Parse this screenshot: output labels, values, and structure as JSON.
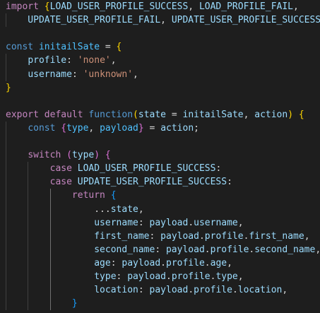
{
  "theme": {
    "background": "#1e1e1e",
    "keyword_control": "#c586c0",
    "keyword_storage": "#569cd6",
    "function": "#dcdcaa",
    "variable": "#9cdcfe",
    "constant": "#4fc1ff",
    "string": "#ce9178",
    "punctuation": "#d4d4d4",
    "bracket_1": "#ffd700",
    "bracket_2": "#da70d6",
    "bracket_3": "#179fff"
  },
  "lines": [
    [
      {
        "t": "import ",
        "c": "keyword_control"
      },
      {
        "t": "{",
        "c": "bracket_1"
      },
      {
        "t": "LOAD_USER_PROFILE_SUCCESS",
        "c": "variable"
      },
      {
        "t": ", ",
        "c": "punctuation"
      },
      {
        "t": "LOAD_PROFILE_FAIL",
        "c": "variable"
      },
      {
        "t": ",",
        "c": "punctuation"
      }
    ],
    [
      {
        "t": "    UPDATE_USER_PROFILE_FAIL",
        "c": "variable"
      },
      {
        "t": ", ",
        "c": "punctuation"
      },
      {
        "t": "UPDATE_USER_PROFILE_SUCCESS",
        "c": "variable"
      },
      {
        "t": ",",
        "c": "punctuation"
      }
    ],
    [],
    [
      {
        "t": "const ",
        "c": "keyword_storage"
      },
      {
        "t": "initailSate",
        "c": "constant"
      },
      {
        "t": " = ",
        "c": "punctuation"
      },
      {
        "t": "{",
        "c": "bracket_1"
      }
    ],
    [
      {
        "t": "    ",
        "c": "punctuation"
      },
      {
        "t": "profile",
        "c": "variable"
      },
      {
        "t": ": ",
        "c": "punctuation"
      },
      {
        "t": "'none'",
        "c": "string"
      },
      {
        "t": ",",
        "c": "punctuation"
      }
    ],
    [
      {
        "t": "    ",
        "c": "punctuation"
      },
      {
        "t": "username",
        "c": "variable"
      },
      {
        "t": ": ",
        "c": "punctuation"
      },
      {
        "t": "'unknown'",
        "c": "string"
      },
      {
        "t": ",",
        "c": "punctuation"
      }
    ],
    [
      {
        "t": "}",
        "c": "bracket_1"
      }
    ],
    [],
    [
      {
        "t": "export ",
        "c": "keyword_control"
      },
      {
        "t": "default ",
        "c": "keyword_control"
      },
      {
        "t": "function",
        "c": "keyword_storage"
      },
      {
        "t": "(",
        "c": "bracket_1"
      },
      {
        "t": "state",
        "c": "variable"
      },
      {
        "t": " = ",
        "c": "punctuation"
      },
      {
        "t": "initailSate",
        "c": "variable"
      },
      {
        "t": ", ",
        "c": "punctuation"
      },
      {
        "t": "action",
        "c": "variable"
      },
      {
        "t": ")",
        "c": "bracket_1"
      },
      {
        "t": " ",
        "c": "punctuation"
      },
      {
        "t": "{",
        "c": "bracket_1"
      }
    ],
    [
      {
        "t": "    ",
        "c": "punctuation"
      },
      {
        "t": "const ",
        "c": "keyword_storage"
      },
      {
        "t": "{",
        "c": "bracket_2"
      },
      {
        "t": "type",
        "c": "constant"
      },
      {
        "t": ", ",
        "c": "punctuation"
      },
      {
        "t": "payload",
        "c": "constant"
      },
      {
        "t": "}",
        "c": "bracket_2"
      },
      {
        "t": " = ",
        "c": "punctuation"
      },
      {
        "t": "action",
        "c": "variable"
      },
      {
        "t": ";",
        "c": "punctuation"
      }
    ],
    [],
    [
      {
        "t": "    ",
        "c": "punctuation"
      },
      {
        "t": "switch ",
        "c": "keyword_control"
      },
      {
        "t": "(",
        "c": "bracket_2"
      },
      {
        "t": "type",
        "c": "variable"
      },
      {
        "t": ")",
        "c": "bracket_2"
      },
      {
        "t": " ",
        "c": "punctuation"
      },
      {
        "t": "{",
        "c": "bracket_2"
      }
    ],
    [
      {
        "t": "        ",
        "c": "punctuation"
      },
      {
        "t": "case ",
        "c": "keyword_control"
      },
      {
        "t": "LOAD_USER_PROFILE_SUCCESS",
        "c": "variable"
      },
      {
        "t": ":",
        "c": "punctuation"
      }
    ],
    [
      {
        "t": "        ",
        "c": "punctuation"
      },
      {
        "t": "case ",
        "c": "keyword_control"
      },
      {
        "t": "UPDATE_USER_PROFILE_SUCCESS",
        "c": "variable"
      },
      {
        "t": ":",
        "c": "punctuation"
      }
    ],
    [
      {
        "t": "            ",
        "c": "punctuation"
      },
      {
        "t": "return ",
        "c": "keyword_control"
      },
      {
        "t": "{",
        "c": "bracket_3"
      }
    ],
    [
      {
        "t": "                ...",
        "c": "punctuation"
      },
      {
        "t": "state",
        "c": "variable"
      },
      {
        "t": ",",
        "c": "punctuation"
      }
    ],
    [
      {
        "t": "                ",
        "c": "punctuation"
      },
      {
        "t": "username",
        "c": "variable"
      },
      {
        "t": ": ",
        "c": "punctuation"
      },
      {
        "t": "payload",
        "c": "variable"
      },
      {
        "t": ".",
        "c": "punctuation"
      },
      {
        "t": "username",
        "c": "variable"
      },
      {
        "t": ",",
        "c": "punctuation"
      }
    ],
    [
      {
        "t": "                ",
        "c": "punctuation"
      },
      {
        "t": "first_name",
        "c": "variable"
      },
      {
        "t": ": ",
        "c": "punctuation"
      },
      {
        "t": "payload",
        "c": "variable"
      },
      {
        "t": ".",
        "c": "punctuation"
      },
      {
        "t": "profile",
        "c": "variable"
      },
      {
        "t": ".",
        "c": "punctuation"
      },
      {
        "t": "first_name",
        "c": "variable"
      },
      {
        "t": ",",
        "c": "punctuation"
      }
    ],
    [
      {
        "t": "                ",
        "c": "punctuation"
      },
      {
        "t": "second_name",
        "c": "variable"
      },
      {
        "t": ": ",
        "c": "punctuation"
      },
      {
        "t": "payload",
        "c": "variable"
      },
      {
        "t": ".",
        "c": "punctuation"
      },
      {
        "t": "profile",
        "c": "variable"
      },
      {
        "t": ".",
        "c": "punctuation"
      },
      {
        "t": "second_name",
        "c": "variable"
      },
      {
        "t": ",",
        "c": "punctuation"
      }
    ],
    [
      {
        "t": "                ",
        "c": "punctuation"
      },
      {
        "t": "age",
        "c": "variable"
      },
      {
        "t": ": ",
        "c": "punctuation"
      },
      {
        "t": "payload",
        "c": "variable"
      },
      {
        "t": ".",
        "c": "punctuation"
      },
      {
        "t": "profile",
        "c": "variable"
      },
      {
        "t": ".",
        "c": "punctuation"
      },
      {
        "t": "age",
        "c": "variable"
      },
      {
        "t": ",",
        "c": "punctuation"
      }
    ],
    [
      {
        "t": "                ",
        "c": "punctuation"
      },
      {
        "t": "type",
        "c": "variable"
      },
      {
        "t": ": ",
        "c": "punctuation"
      },
      {
        "t": "payload",
        "c": "variable"
      },
      {
        "t": ".",
        "c": "punctuation"
      },
      {
        "t": "profile",
        "c": "variable"
      },
      {
        "t": ".",
        "c": "punctuation"
      },
      {
        "t": "type",
        "c": "variable"
      },
      {
        "t": ",",
        "c": "punctuation"
      }
    ],
    [
      {
        "t": "                ",
        "c": "punctuation"
      },
      {
        "t": "location",
        "c": "variable"
      },
      {
        "t": ": ",
        "c": "punctuation"
      },
      {
        "t": "payload",
        "c": "variable"
      },
      {
        "t": ".",
        "c": "punctuation"
      },
      {
        "t": "profile",
        "c": "variable"
      },
      {
        "t": ".",
        "c": "punctuation"
      },
      {
        "t": "location",
        "c": "variable"
      },
      {
        "t": ",",
        "c": "punctuation"
      }
    ],
    [
      {
        "t": "            ",
        "c": "punctuation"
      },
      {
        "t": "}",
        "c": "bracket_3"
      }
    ]
  ]
}
